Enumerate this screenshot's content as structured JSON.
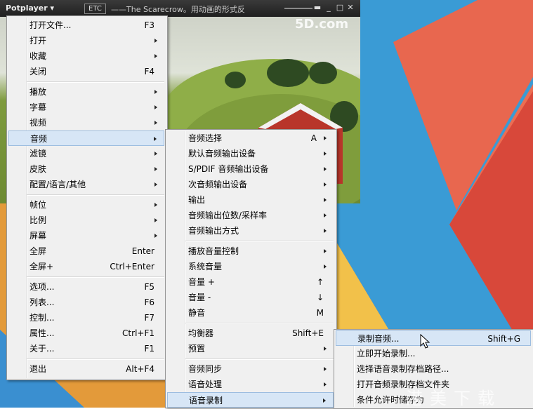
{
  "window": {
    "brand": "Potplayer",
    "etc_label": "ETC",
    "title": "——The Scarecrow。用动画的形式反",
    "video_logo": "5D.com"
  },
  "main_menu": {
    "items": [
      {
        "label": "打开文件...",
        "shortcut": "F3"
      },
      {
        "label": "打开",
        "shortcut": ""
      },
      {
        "label": "收藏",
        "shortcut": ""
      },
      {
        "label": "关闭",
        "shortcut": "F4"
      },
      {
        "label": "播放",
        "shortcut": ""
      },
      {
        "label": "字幕",
        "shortcut": ""
      },
      {
        "label": "视频",
        "shortcut": ""
      },
      {
        "label": "音频",
        "shortcut": ""
      },
      {
        "label": "滤镜",
        "shortcut": ""
      },
      {
        "label": "皮肤",
        "shortcut": ""
      },
      {
        "label": "配置/语言/其他",
        "shortcut": ""
      },
      {
        "label": "帧位",
        "shortcut": ""
      },
      {
        "label": "比例",
        "shortcut": ""
      },
      {
        "label": "屏幕",
        "shortcut": ""
      },
      {
        "label": "全屏",
        "shortcut": "Enter"
      },
      {
        "label": "全屏+",
        "shortcut": "Ctrl+Enter"
      },
      {
        "label": "选项...",
        "shortcut": "F5"
      },
      {
        "label": "列表...",
        "shortcut": "F6"
      },
      {
        "label": "控制...",
        "shortcut": "F7"
      },
      {
        "label": "属性...",
        "shortcut": "Ctrl+F1"
      },
      {
        "label": "关于...",
        "shortcut": "F1"
      },
      {
        "label": "退出",
        "shortcut": "Alt+F4"
      }
    ]
  },
  "audio_menu": {
    "items": [
      {
        "label": "音频选择",
        "shortcut": "A"
      },
      {
        "label": "默认音频输出设备",
        "shortcut": ""
      },
      {
        "label": "S/PDIF 音频输出设备",
        "shortcut": ""
      },
      {
        "label": "次音频输出设备",
        "shortcut": ""
      },
      {
        "label": "输出",
        "shortcut": ""
      },
      {
        "label": "音频输出位数/采样率",
        "shortcut": ""
      },
      {
        "label": "音频输出方式",
        "shortcut": ""
      },
      {
        "label": "播放音量控制",
        "shortcut": ""
      },
      {
        "label": "系统音量",
        "shortcut": ""
      },
      {
        "label": "音量 +",
        "shortcut": "↑"
      },
      {
        "label": "音量 -",
        "shortcut": "↓"
      },
      {
        "label": "静音",
        "shortcut": "M"
      },
      {
        "label": "均衡器",
        "shortcut": "Shift+E"
      },
      {
        "label": "预置",
        "shortcut": ""
      },
      {
        "label": "音频同步",
        "shortcut": ""
      },
      {
        "label": "语音处理",
        "shortcut": ""
      },
      {
        "label": "语音录制",
        "shortcut": ""
      }
    ]
  },
  "record_menu": {
    "items": [
      {
        "label": "录制音频...",
        "shortcut": "Shift+G"
      },
      {
        "label": "立即开始录制...",
        "shortcut": ""
      },
      {
        "label": "选择语音录制存档路径...",
        "shortcut": ""
      },
      {
        "label": "打开音频录制存档文件夹",
        "shortcut": ""
      },
      {
        "label": "条件允许时储存为",
        "shortcut": ""
      }
    ]
  },
  "watermark": "港美下载",
  "colors": {
    "highlight": "#d7e6f6",
    "highlight_border": "#9dbde0",
    "menu_bg": "#f0f0f0"
  }
}
